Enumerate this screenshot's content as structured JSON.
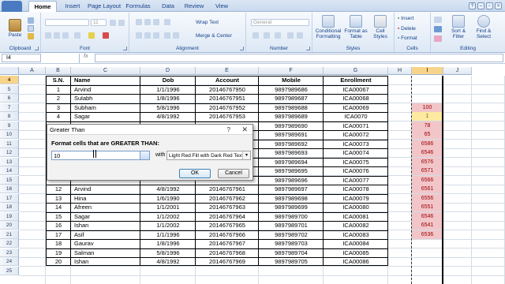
{
  "ribbon": {
    "file_tab": "",
    "tabs": [
      "Home",
      "Insert",
      "Page Layout",
      "Formulas",
      "Data",
      "Review",
      "View"
    ],
    "active_tab": "Home",
    "groups": {
      "clipboard": {
        "label": "Clipboard",
        "paste": "Paste"
      },
      "font": {
        "label": "Font",
        "font_name": "",
        "font_size": "11"
      },
      "alignment": {
        "label": "Alignment",
        "wrap_text": "Wrap Text",
        "merge_center": "Merge & Center"
      },
      "number": {
        "label": "Number",
        "format": "General"
      },
      "styles": {
        "label": "Styles",
        "conditional_formatting": "Conditional Formatting",
        "format_as_table": "Format as Table",
        "cell_styles": "Cell Styles"
      },
      "cells": {
        "label": "Cells",
        "insert": "Insert",
        "delete": "Delete",
        "format": "Format"
      },
      "editing": {
        "label": "Editing",
        "sort_filter": "Sort & Filter",
        "find_select": "Find & Select"
      }
    }
  },
  "formula_bar": {
    "name_box": "I4",
    "fx": "fx",
    "value": ""
  },
  "columns": [
    "A",
    "B",
    "C",
    "D",
    "E",
    "F",
    "G",
    "H",
    "I",
    "J"
  ],
  "row_numbers": [
    "4",
    "5",
    "6",
    "7",
    "8",
    "9",
    "10",
    "11",
    "12",
    "13",
    "14",
    "15",
    "16",
    "17",
    "18",
    "19",
    "20",
    "21",
    "22",
    "23",
    "24",
    "25"
  ],
  "selected_column": "I",
  "selected_row": "4",
  "table": {
    "headers": [
      "S.N.",
      "Name",
      "Dob",
      "Account",
      "Mobile",
      "Enrollment"
    ],
    "rows": [
      [
        "1",
        "Arvind",
        "1/1/1996",
        "20146767950",
        "9897989686",
        "ICA00067"
      ],
      [
        "2",
        "Sulabh",
        "1/8/1996",
        "20146767951",
        "9897989687",
        "ICA00068"
      ],
      [
        "3",
        "Subham",
        "5/8/1996",
        "20146767952",
        "9897989688",
        "ICA00069"
      ],
      [
        "4",
        "Sagar",
        "4/8/1992",
        "20146767953",
        "9897989689",
        "ICA0070"
      ],
      [
        "",
        "",
        "",
        "",
        "9897989690",
        "ICA00071"
      ],
      [
        "",
        "",
        "",
        "",
        "9897989691",
        "ICA00072"
      ],
      [
        "",
        "",
        "",
        "",
        "9897989692",
        "ICA00073"
      ],
      [
        "",
        "",
        "",
        "",
        "9897989693",
        "ICA00074"
      ],
      [
        "",
        "",
        "",
        "",
        "9897989694",
        "ICA00075"
      ],
      [
        "",
        "",
        "",
        "",
        "9897989695",
        "ICA00076"
      ],
      [
        "",
        "",
        "",
        "",
        "9897989696",
        "ICA00077"
      ],
      [
        "12",
        "Arvind",
        "4/8/1992",
        "20146767961",
        "9897989697",
        "ICA00078"
      ],
      [
        "13",
        "Hina",
        "1/6/1990",
        "20146767962",
        "9897989698",
        "ICA00079"
      ],
      [
        "14",
        "Afreen",
        "1/1/2001",
        "20146767963",
        "9897989699",
        "ICA00080"
      ],
      [
        "15",
        "Sagar",
        "1/1/2002",
        "20146767964",
        "9897989700",
        "ICA00081"
      ],
      [
        "16",
        "Ishan",
        "1/1/2002",
        "20146767965",
        "9897989701",
        "ICA00082"
      ],
      [
        "17",
        "Asif",
        "1/1/1996",
        "20146767966",
        "9897989702",
        "ICA00083"
      ],
      [
        "18",
        "Gaurav",
        "1/8/1996",
        "20146767967",
        "9897989703",
        "ICA00084"
      ],
      [
        "19",
        "Salman",
        "5/8/1996",
        "20146767968",
        "9897989704",
        "ICA00085"
      ],
      [
        "20",
        "Ishan",
        "4/8/1992",
        "20146767969",
        "9897989705",
        "ICA00086"
      ]
    ]
  },
  "column_i_values": [
    "100",
    "1",
    "78",
    "65",
    "6586",
    "6546",
    "6576",
    "6571",
    "6566",
    "6561",
    "6556",
    "6551",
    "6546",
    "6541",
    "6536"
  ],
  "highlight_colors": {
    "fill": "#f2c6c9",
    "text": "#9c0006",
    "yellow_fill": "#fdeaa0"
  },
  "dialog": {
    "title": "Greater Than",
    "help": "?",
    "close": "✕",
    "prompt": "Format cells that are GREATER THAN:",
    "value": "10",
    "with_label": "with",
    "format_option": "Light Red Fill with Dark Red Text",
    "ok": "OK",
    "cancel": "Cancel"
  }
}
